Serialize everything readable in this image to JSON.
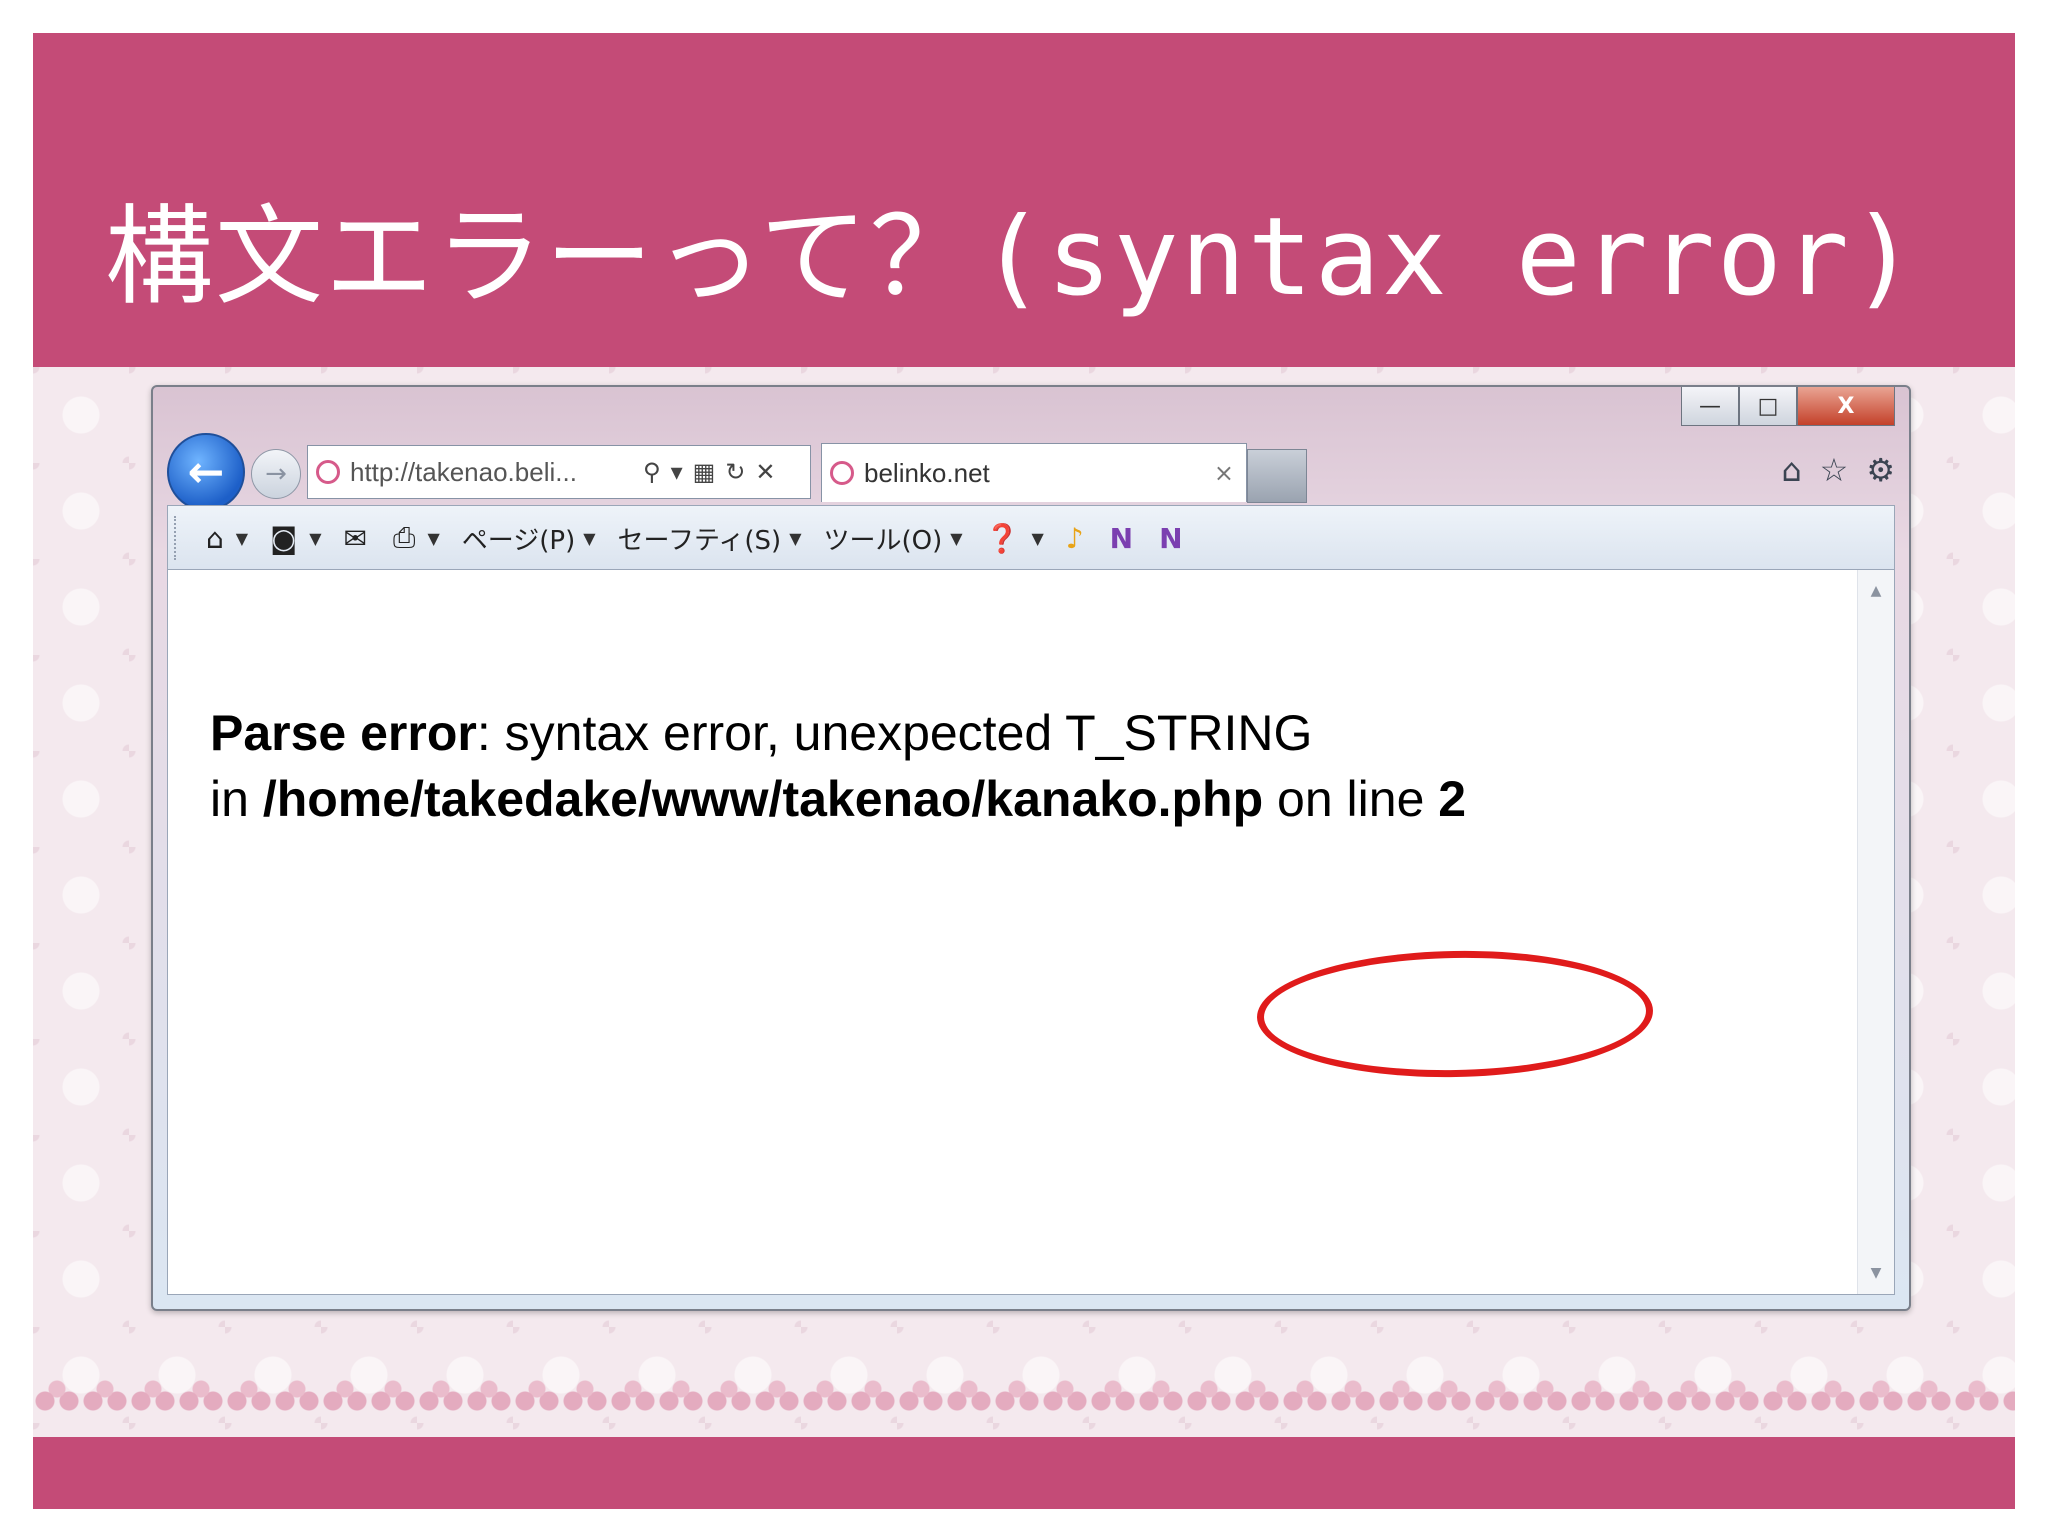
{
  "slide": {
    "title": "構文エラーって？(syntax error)"
  },
  "browser": {
    "window_controls": {
      "minimize": "—",
      "maximize": "□",
      "close": "X"
    },
    "address": {
      "url": "http://takenao.beli..."
    },
    "tab": {
      "label": "belinko.net",
      "close": "×"
    },
    "commandbar": {
      "page": "ページ(P)",
      "safety": "セーフティ(S)",
      "tools": "ツール(O)"
    },
    "icons": {
      "back": "back-arrow-icon",
      "forward": "forward-arrow-icon",
      "home": "home-icon",
      "favorites": "star-icon",
      "settings": "gear-icon"
    }
  },
  "page": {
    "error_label": "Parse error",
    "error_sep": ":",
    "error_text": " syntax error, unexpected T_STRING",
    "in_word": "in ",
    "file_path": "/home/takedake/www/takenao/kanako.php",
    "on_line": " on line ",
    "line_number": "2"
  },
  "colors": {
    "band": "#c44b77",
    "annotation": "#e01b1b"
  }
}
